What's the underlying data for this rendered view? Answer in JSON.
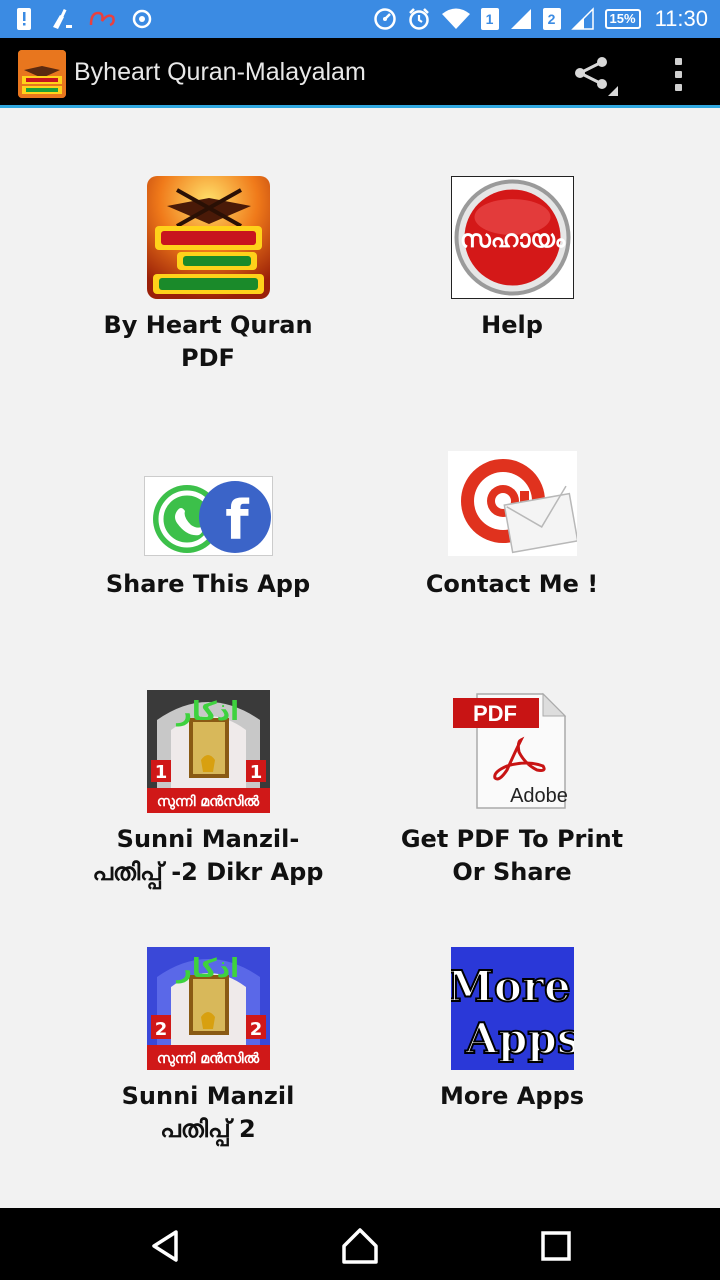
{
  "status_bar": {
    "left_icons": [
      "alert-icon",
      "cleaner-icon",
      "carrier-icon",
      "sync-icon"
    ],
    "right_icons": [
      "data-saver-icon",
      "alarm-icon",
      "wifi-icon",
      "sim1-signal-icon",
      "sim2-signal-icon"
    ],
    "sim1": "1",
    "sim2": "2",
    "battery": "15%",
    "time": "11:30"
  },
  "app_bar": {
    "title": "Byheart Quran-Malayalam",
    "share_icon": "share-icon",
    "menu_icon": "overflow-menu-icon"
  },
  "grid": {
    "items": [
      {
        "label_line1": "By Heart Quran",
        "label_line2": "PDF",
        "icon": "quran-book-icon"
      },
      {
        "label_line1": "Help",
        "label_line2": "",
        "icon": "help-button-icon",
        "icon_text": "സഹായം"
      },
      {
        "label_line1": "Share This App",
        "label_line2": "",
        "icon": "whatsapp-facebook-icon"
      },
      {
        "label_line1": "Contact Me !",
        "label_line2": "",
        "icon": "email-at-icon"
      },
      {
        "label_line1": "Sunni Manzil-",
        "label_line2": "പതിപ്പ് -2 Dikr App",
        "icon": "sunni-manzil-1-icon",
        "badge": "1",
        "banner": "സുന്നി മൻസിൽ"
      },
      {
        "label_line1": "Get PDF To Print",
        "label_line2": "Or Share",
        "icon": "pdf-adobe-icon",
        "pdf_tag": "PDF",
        "brand": "Adobe"
      },
      {
        "label_line1": "Sunni Manzil",
        "label_line2": "പതിപ്പ് 2",
        "icon": "sunni-manzil-2-icon",
        "badge": "2",
        "banner": "സുന്നി മൻസിൽ"
      },
      {
        "label_line1": "More Apps",
        "label_line2": "",
        "icon": "more-apps-icon",
        "tile_line1": "More",
        "tile_line2": "Apps"
      }
    ]
  },
  "nav_bar": {
    "back": "back-icon",
    "home": "home-icon",
    "recents": "recents-icon"
  },
  "colors": {
    "status_bar": "#3b8be3",
    "app_bar": "#000000",
    "accent_line": "#30a8e0",
    "background": "#f2f2f2",
    "more_apps_tile": "#2a38d8",
    "help_red": "#d41818"
  }
}
